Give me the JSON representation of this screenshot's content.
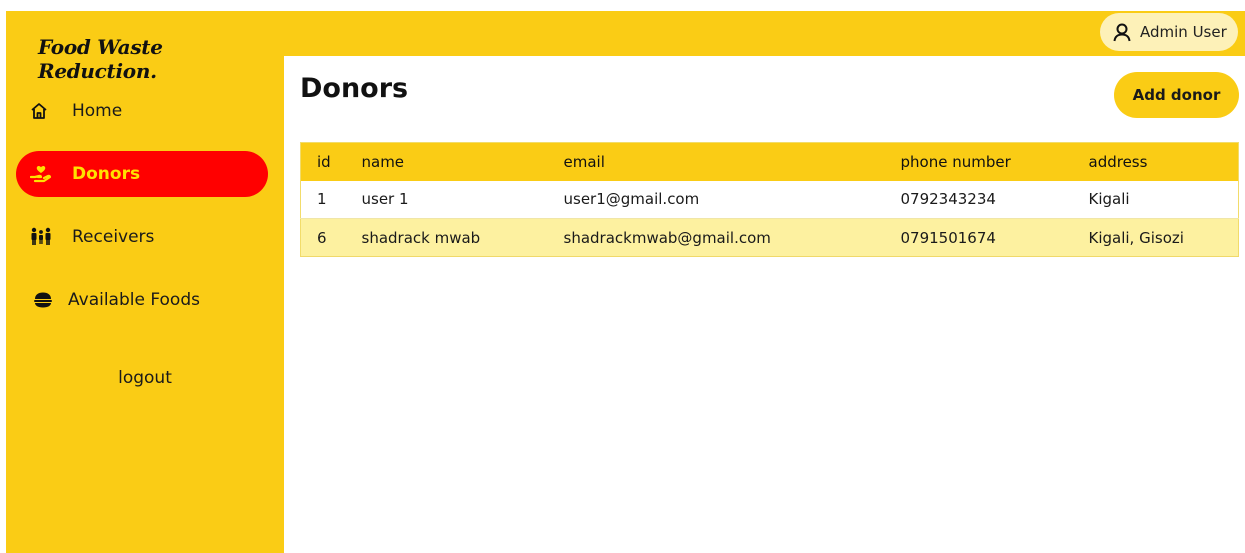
{
  "brand": "Food Waste Reduction.",
  "sidebar": {
    "items": [
      {
        "label": "Home",
        "icon": "home-icon",
        "active": false
      },
      {
        "label": "Donors",
        "icon": "donor-hand-heart-icon",
        "active": true
      },
      {
        "label": "Receivers",
        "icon": "people-icon",
        "active": false
      },
      {
        "label": "Available Foods",
        "icon": "food-icon",
        "active": false
      }
    ],
    "logout": "logout"
  },
  "topbar": {
    "user": "Admin User",
    "user_icon": "user-icon"
  },
  "main": {
    "title": "Donors",
    "add_button": "Add donor",
    "table": {
      "columns": [
        "id",
        "name",
        "email",
        "phone number",
        "address"
      ],
      "rows": [
        [
          "1",
          "user 1",
          "user1@gmail.com",
          "0792343234",
          "Kigali"
        ],
        [
          "6",
          "shadrack mwab",
          "shadrackmwab@gmail.com",
          "0791501674",
          "Kigali, Gisozi"
        ]
      ]
    }
  },
  "colors": {
    "accent": "#facc15",
    "active": "#ff0000",
    "active_text": "#ffe100",
    "row_alt": "#fdf1a0"
  }
}
